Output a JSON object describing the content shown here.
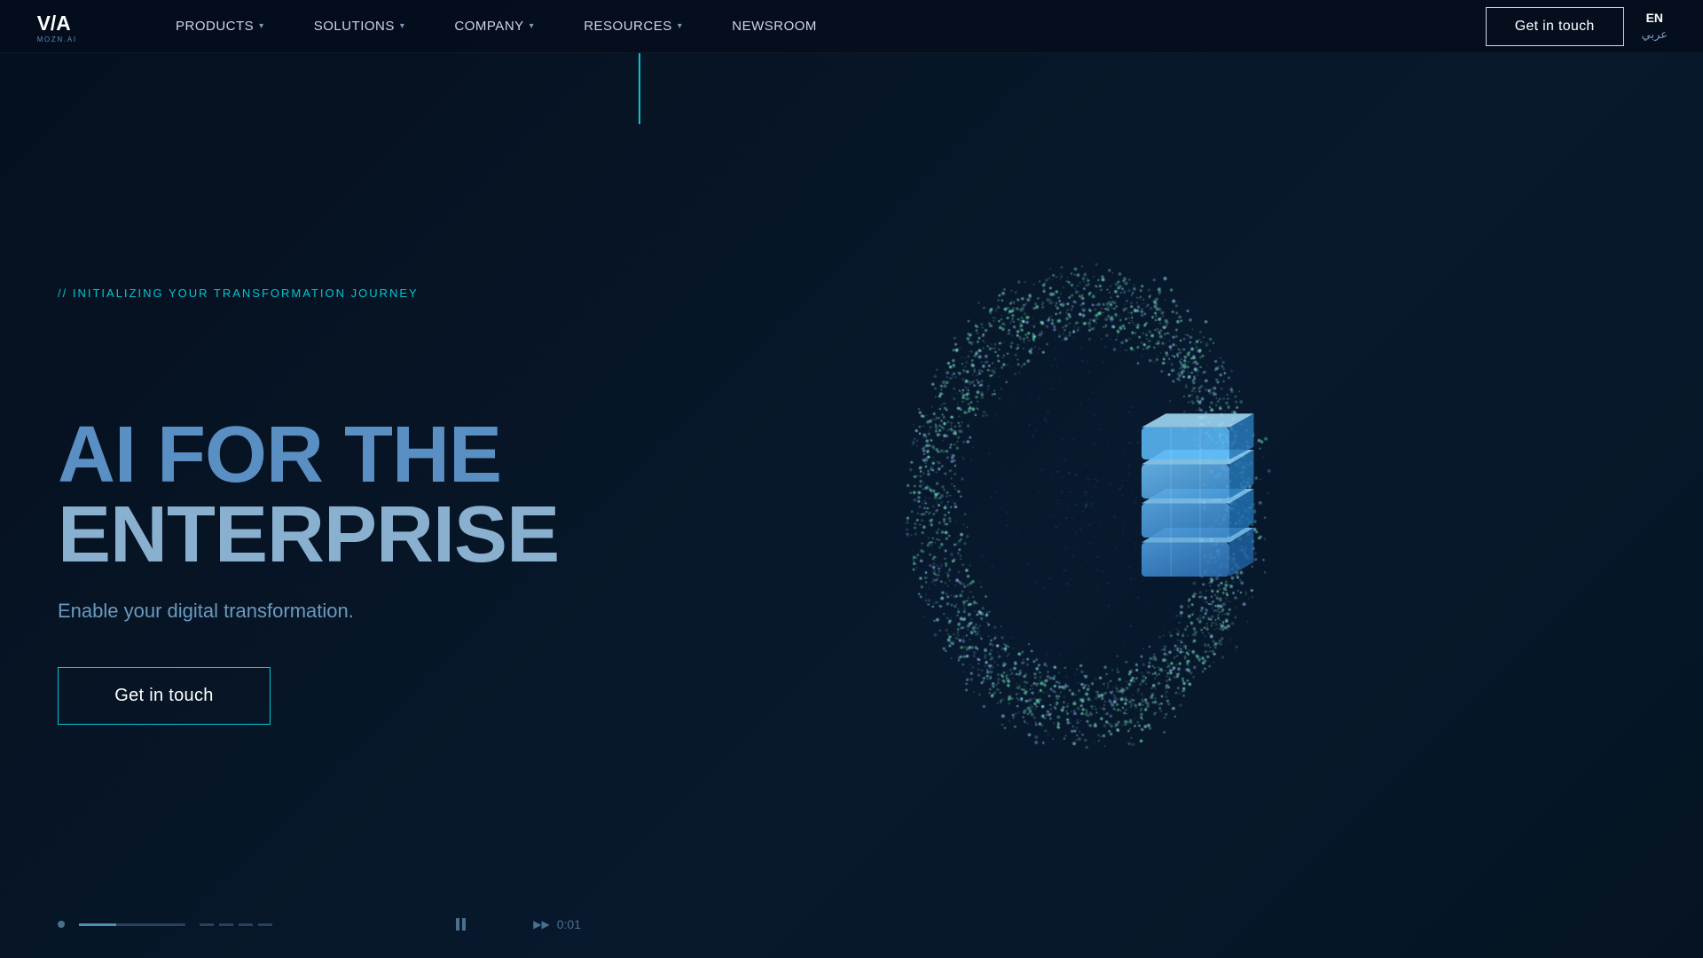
{
  "header": {
    "logo_alt": "VIA Mozn AI",
    "nav": [
      {
        "label": "PRODUCTS",
        "has_dropdown": true,
        "active": false
      },
      {
        "label": "SOLUTIONS",
        "has_dropdown": true,
        "active": false
      },
      {
        "label": "COMPANY",
        "has_dropdown": true,
        "active": false
      },
      {
        "label": "RESOURCES",
        "has_dropdown": true,
        "active": false
      },
      {
        "label": "NEWSROOM",
        "has_dropdown": false,
        "active": false
      }
    ],
    "cta_label": "Get in touch",
    "lang_en": "EN",
    "lang_ar": "عربي"
  },
  "hero": {
    "tagline_prefix": "// ",
    "tagline": "INITIALIZING YOUR TRANSFORMATION JOURNEY",
    "title_ai": "AI FOR THE",
    "title_enterprise": "ENTERPRISE",
    "subtitle": "Enable your digital transformation.",
    "cta_label": "Get in touch"
  },
  "progress": {
    "timer": "0:01",
    "play_label": "▶▶"
  },
  "colors": {
    "accent": "#00c8d4",
    "background": "#05111f",
    "text_dim": "#7a99bb"
  }
}
